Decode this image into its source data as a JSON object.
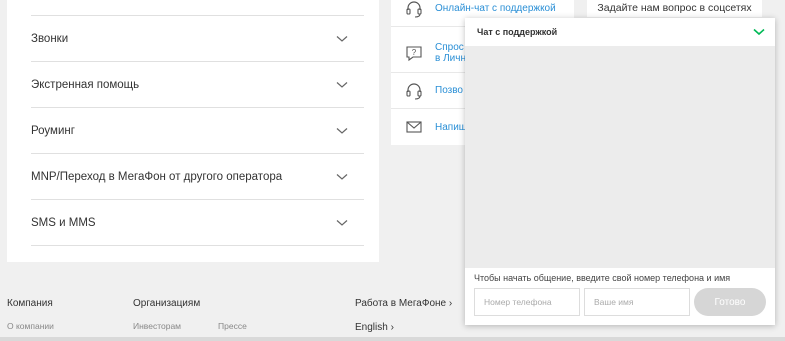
{
  "faq": {
    "items": [
      {
        "label": "Звонки"
      },
      {
        "label": "Экстренная помощь"
      },
      {
        "label": "Роуминг"
      },
      {
        "label": "MNP/Переход в МегаФон от другого оператора"
      },
      {
        "label": "SMS и MMS"
      }
    ]
  },
  "support": {
    "online_chat": "Онлайн-чат с поддержкой",
    "ask_line1": "Спрос",
    "ask_line2": "в Личн",
    "call": "Позво",
    "write": "Напиш"
  },
  "social_text": "Задайте нам вопрос в соцсетях",
  "footer": {
    "company": "Компания",
    "about": "О компании",
    "orgs": "Организациям",
    "investors": "Инвесторам",
    "press": "Прессе",
    "career": "Работа в МегаФоне ›",
    "language": "English ›"
  },
  "chat": {
    "title": "Чат с поддержкой",
    "hint": "Чтобы начать общение, введите свой номер телефона и имя",
    "phone_placeholder": "Номер телефона",
    "name_placeholder": "Ваше имя",
    "submit": "Готово",
    "accent": "#00b956"
  },
  "colors": {
    "link": "#2a8fd6",
    "page_bg": "#f0f0f0"
  }
}
